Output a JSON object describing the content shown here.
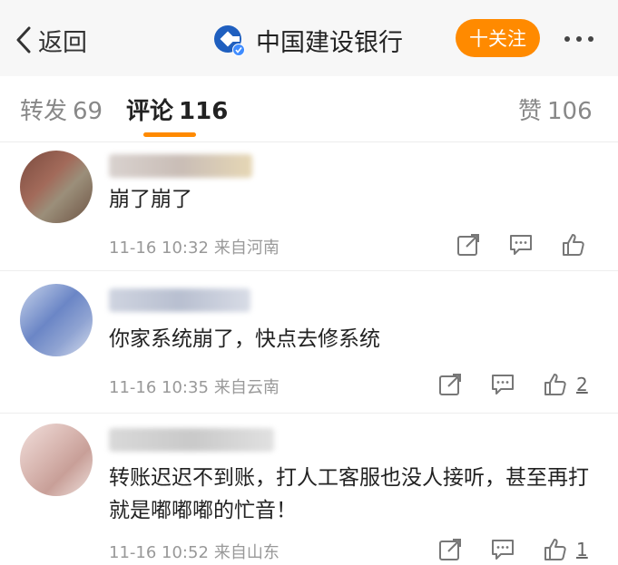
{
  "header": {
    "back_label": "返回",
    "title": "中国建设银行",
    "follow_label": "十关注",
    "brand_color": "#1f5fbf",
    "accent": "#ff8a00"
  },
  "tabs": {
    "forward": {
      "label": "转发",
      "count": "69"
    },
    "comments": {
      "label": "评论",
      "count": "116"
    },
    "likes": {
      "label": "赞",
      "count": "106"
    }
  },
  "comments": [
    {
      "content": "崩了崩了",
      "time": "11-16 10:32",
      "location": "来自河南",
      "likes": ""
    },
    {
      "content": "你家系统崩了，快点去修系统",
      "time": "11-16 10:35",
      "location": "来自云南",
      "likes": "2"
    },
    {
      "content": "转账迟迟不到账，打人工客服也没人接听，甚至再打就是嘟嘟嘟的忙音！",
      "time": "11-16 10:52",
      "location": "来自山东",
      "likes": "1"
    }
  ],
  "icons": [
    "chevron-left-icon",
    "bank-logo-icon",
    "verified-badge-icon",
    "share-icon",
    "comment-icon",
    "thumbs-up-icon",
    "more-icon"
  ]
}
